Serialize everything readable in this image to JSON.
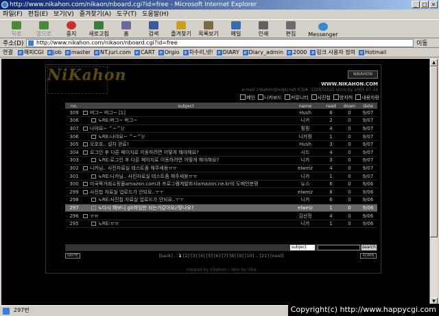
{
  "window": {
    "title": "http://www.nikahon.com/nikaon/nboard.cgi?id=free - Microsoft Internet Explorer"
  },
  "menu": [
    "파일(F)",
    "편집(E)",
    "보기(V)",
    "즐겨찾기(A)",
    "도구(T)",
    "도움말(H)"
  ],
  "toolbar": [
    {
      "label": "뒤로",
      "icon": "back-arrow-icon"
    },
    {
      "label": "앞으로",
      "icon": "forward-arrow-icon"
    },
    {
      "label": "중지",
      "icon": "stop-icon"
    },
    {
      "label": "새로고침",
      "icon": "refresh-icon"
    },
    {
      "label": "홈",
      "icon": "home-icon"
    },
    {
      "label": "검색",
      "icon": "search-icon"
    },
    {
      "label": "즐겨찾기",
      "icon": "favorites-icon"
    },
    {
      "label": "목록보기",
      "icon": "history-icon"
    },
    {
      "label": "메일",
      "icon": "mail-icon"
    },
    {
      "label": "인쇄",
      "icon": "print-icon"
    },
    {
      "label": "편집",
      "icon": "edit-icon"
    },
    {
      "label": "Messenger",
      "icon": "messenger-icon"
    }
  ],
  "address": {
    "label": "주소(D)",
    "url": "http://www.nikahon.com/nikaon/nboard.cgi?id=free",
    "go": "이동"
  },
  "links": {
    "label": "연결",
    "items": [
      "해피CGI",
      "job",
      "master",
      "NT.juri.com",
      "CART",
      "Orgio",
      "차수리,넷!",
      "DIARY",
      "Diary_admin",
      "2000",
      "링크 사용자 정의",
      "Hotmail"
    ]
  },
  "board": {
    "logo": "NiKahon",
    "badge": "NIKAHON",
    "site": "WWW.NIKAHON.COM",
    "email": "e-mail :nikahon@orgio.net ICQ# :120072525 since by 2001-07-14",
    "nav": [
      "메인",
      "니카보드",
      "커뮤니티",
      "사진첩",
      "방지허",
      "내용자랑"
    ],
    "headers": [
      "no.",
      "subject",
      "name",
      "read",
      "down",
      "date"
    ],
    "rows": [
      {
        "no": "309",
        "subject": "버그~ 버그~ [1]",
        "reply": false,
        "name": "Hush",
        "read": "8",
        "down": "0",
        "date": "9/07"
      },
      {
        "no": "308",
        "subject": "↳RE:버그~ 버그~",
        "reply": true,
        "name": "니카",
        "read": "2",
        "down": "0",
        "date": "9/07"
      },
      {
        "no": "307",
        "subject": "나야요~ ^~^)/",
        "reply": false,
        "name": "핑핑",
        "read": "4",
        "down": "0",
        "date": "9/07"
      },
      {
        "no": "306",
        "subject": "↳RE:나야요~ ^~^)/",
        "reply": true,
        "name": "니카짱",
        "read": "1",
        "down": "0",
        "date": "9/07"
      },
      {
        "no": "305",
        "subject": "오호호.. 설치 완료!",
        "reply": false,
        "name": "Hush",
        "read": "3",
        "down": "0",
        "date": "9/07"
      },
      {
        "no": "304",
        "subject": "로그인 후 다른 페이지로 이동하려면 어떻게 해야해요?",
        "reply": false,
        "name": "시드",
        "read": "4",
        "down": "0",
        "date": "9/07"
      },
      {
        "no": "303",
        "subject": "↳RE:로그인 후 다른 페이지로 이동하려면 어떻게 해야해요?",
        "reply": true,
        "name": "니카",
        "read": "3",
        "down": "0",
        "date": "9/07"
      },
      {
        "no": "302",
        "subject": "니카님.. 사진자료실 테스트좀 해주세용ㅠㅠ",
        "reply": false,
        "name": "elweiz",
        "read": "4",
        "down": "0",
        "date": "9/07"
      },
      {
        "no": "301",
        "subject": "↳RE:니카님.. 사진자료실 테스트좀 해주세용ㅠㅠ",
        "reply": true,
        "name": "니카",
        "read": "1",
        "down": "0",
        "date": "9/07"
      },
      {
        "no": "300",
        "subject": "미국쪽거래쇼핑몰amazon.com과 프로그램계발회사amazon.ne.kr의 도메인분쟁",
        "reply": false,
        "name": "뉴스",
        "read": "6",
        "down": "0",
        "date": "9/06"
      },
      {
        "no": "299",
        "subject": "사진첩 자료실 업로드가 안되요..ㅜㅜ",
        "reply": false,
        "name": "elweiz",
        "read": "8",
        "down": "0",
        "date": "9/06"
      },
      {
        "no": "298",
        "subject": "↳RE:사진첩 자료실 업로드가 안되요..ㅜㅜ",
        "reply": true,
        "name": "니카",
        "read": "6",
        "down": "0",
        "date": "9/06"
      },
      {
        "no": "297",
        "subject": "↳다시 해보니 git하임만 되는거같아요//맞나요?",
        "reply": true,
        "name": "elweiz",
        "read": "1",
        "down": "0",
        "date": "9/06",
        "highlight": true
      },
      {
        "no": "296",
        "subject": "ㅠㅠ",
        "reply": false,
        "name": "김선정",
        "read": "4",
        "down": "0",
        "date": "9/06"
      },
      {
        "no": "295",
        "subject": "↳RE:ㅠㅠ",
        "reply": true,
        "name": "니카",
        "read": "1",
        "down": "0",
        "date": "9/06"
      }
    ],
    "search_select": "subject",
    "search_button": "search",
    "write_button": "WRITE",
    "admin_button": "ADMIN",
    "pager": {
      "back": "[back]",
      "current": "1",
      "pages": "[2] [3] [4] [5] [6] [7] [8] [9] [10] .. [21]",
      "next": "[next]"
    },
    "credit": "created by nikahon :: skin by nika"
  },
  "status": {
    "text": "297번"
  },
  "copyright": "Copyright(c) http://www.happycgi.com"
}
